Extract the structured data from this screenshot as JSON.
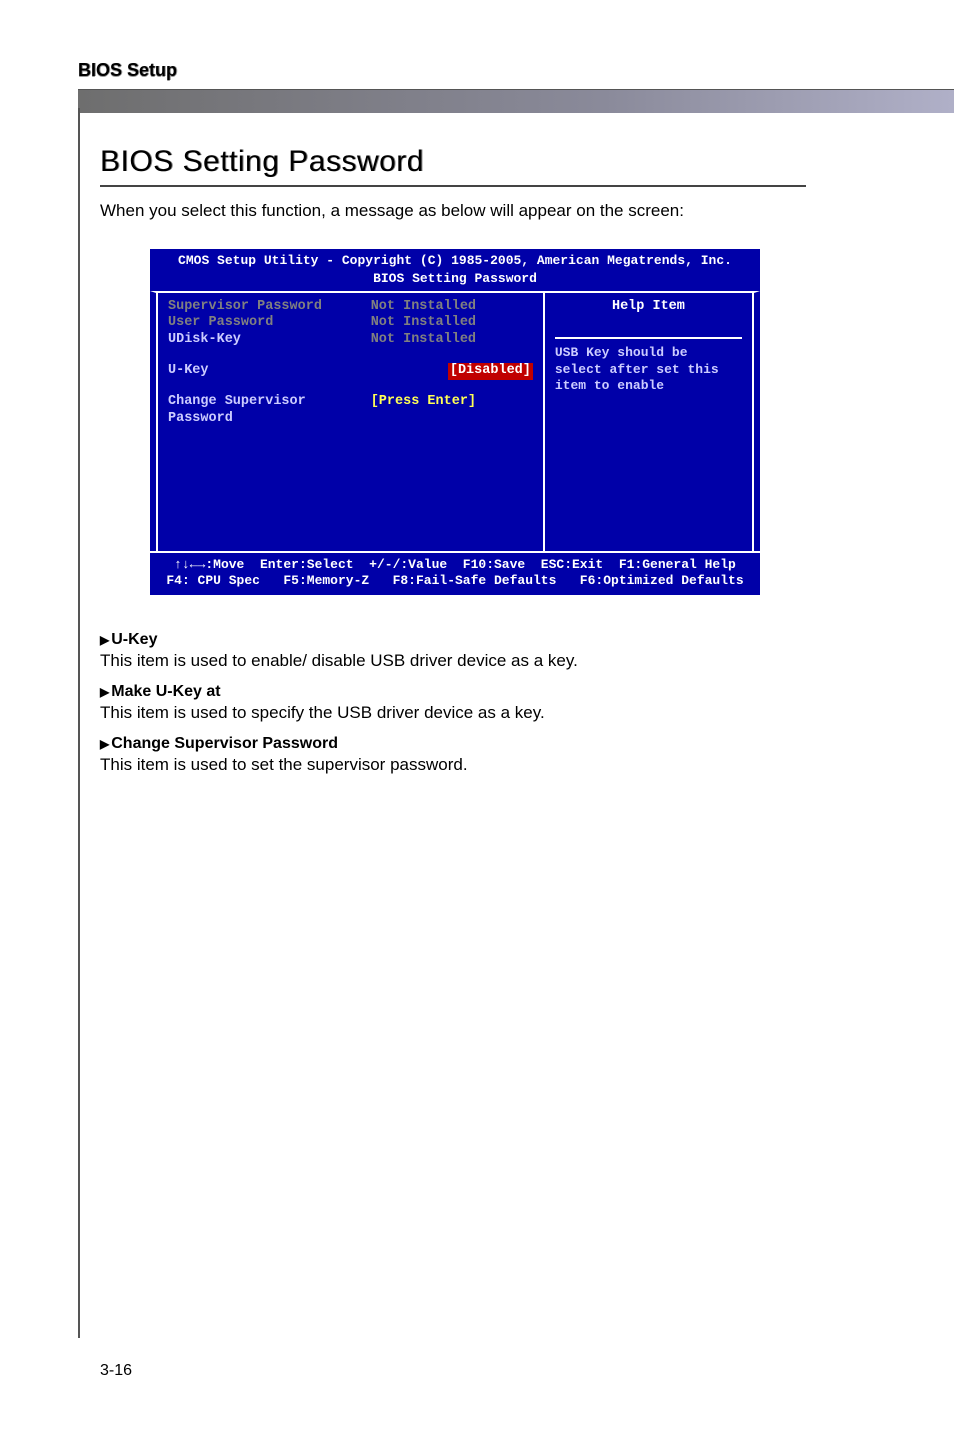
{
  "header": {
    "label": "BIOS Setup"
  },
  "section": {
    "title": "BIOS Setting Password",
    "intro": "When you select this function, a message as below will appear on the screen:"
  },
  "bios": {
    "title_line": "CMOS Setup Utility - Copyright (C) 1985-2005, American Megatrends, Inc.",
    "subtitle": "BIOS Setting Password",
    "rows": [
      {
        "label": "Supervisor Password",
        "value": "Not Installed",
        "label_grey": true,
        "value_grey": true
      },
      {
        "label": "User Password",
        "value": "Not Installed",
        "label_grey": true,
        "value_grey": true
      },
      {
        "label": "UDisk-Key",
        "value": "Not Installed",
        "label_grey": false,
        "value_grey": true
      },
      {
        "label": "",
        "value": ""
      },
      {
        "label": "U-Key",
        "value": "[Disabled]",
        "selected": true
      },
      {
        "label": "",
        "value": ""
      },
      {
        "label": "Change Supervisor Password",
        "value": "[Press Enter]",
        "yellow": true
      }
    ],
    "help": {
      "title": "Help Item",
      "text": "USB Key should be select after set this item to enable"
    },
    "footer1": "↑↓←→:Move  Enter:Select  +/-/:Value  F10:Save  ESC:Exit  F1:General Help",
    "footer2": "F4: CPU Spec   F5:Memory-Z   F8:Fail-Safe Defaults   F6:Optimized Defaults"
  },
  "descriptions": [
    {
      "heading": "U-Key",
      "text": "This item is used to enable/ disable USB driver device as a key."
    },
    {
      "heading": "Make U-Key at",
      "text": "This item is used to specify the USB driver device as a key."
    },
    {
      "heading": "Change Supervisor Password",
      "text": "This item is used to set the supervisor password."
    }
  ],
  "page_number": "3-16"
}
